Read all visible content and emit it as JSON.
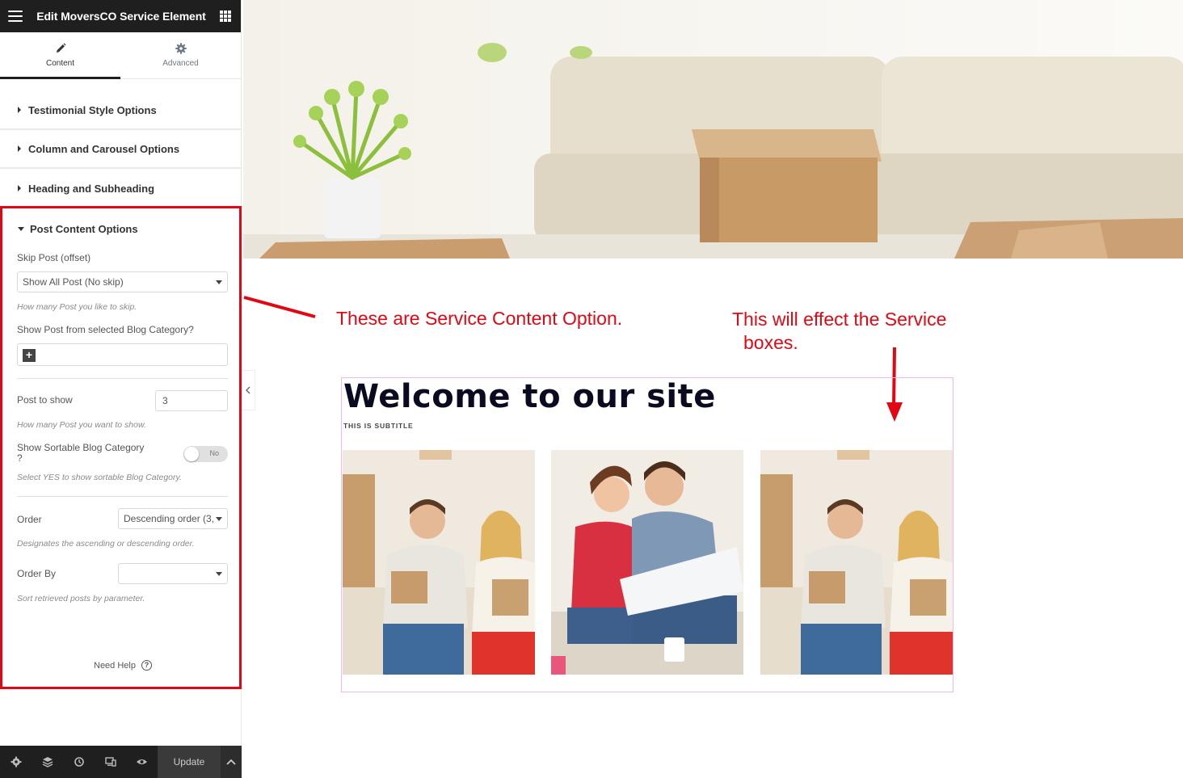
{
  "editor": {
    "title": "Edit MoversCO Service Element",
    "tabs": [
      {
        "label": "Content",
        "icon": "pencil-icon",
        "active": true
      },
      {
        "label": "Advanced",
        "icon": "gear-icon",
        "active": false
      }
    ],
    "sections": [
      {
        "label": "Testimonial Style Options"
      },
      {
        "label": "Column and Carousel Options"
      },
      {
        "label": "Heading and Subheading"
      }
    ],
    "post_content": {
      "heading": "Post Content Options",
      "skip_post_label": "Skip Post (offset)",
      "skip_post_value": "Show All Post (No skip)",
      "skip_post_help": "How many Post you like to skip.",
      "category_label": "Show Post from selected Blog Category?",
      "add_symbol": "+",
      "post_to_show_label": "Post to show",
      "post_to_show_value": "3",
      "post_to_show_help": "How many Post you want to show.",
      "sortable_label_line1": "Show Sortable Blog Category",
      "sortable_label_line2": "?",
      "sortable_toggle": "No",
      "sortable_help": "Select YES to show sortable Blog Category.",
      "order_label": "Order",
      "order_value": "Descending order (3,",
      "order_help": "Designates the ascending or descending order.",
      "order_by_label": "Order By",
      "order_by_value": "",
      "order_by_help": "Sort retrieved posts by parameter.",
      "need_help": "Need Help",
      "help_symbol": "?"
    },
    "bottom_bar": {
      "icons": [
        "gear-icon",
        "layers-icon",
        "history-icon",
        "responsive-icon",
        "eye-icon"
      ],
      "update_label": "Update"
    }
  },
  "preview": {
    "annotation_left": "These are Service Content Option.",
    "annotation_right_line1": "This will effect the Service",
    "annotation_right_line2": "boxes.",
    "title": "Welcome to our site",
    "subtitle": "THIS IS SUBTITLE",
    "cards": [
      {
        "image": "couple-with-boxes"
      },
      {
        "image": "couple-reading-plans"
      },
      {
        "image": "couple-with-boxes"
      }
    ]
  },
  "colors": {
    "annotation_red": "#e30613",
    "topbar": "#1f1f1f",
    "widget_outline": "#f2b7f4"
  }
}
